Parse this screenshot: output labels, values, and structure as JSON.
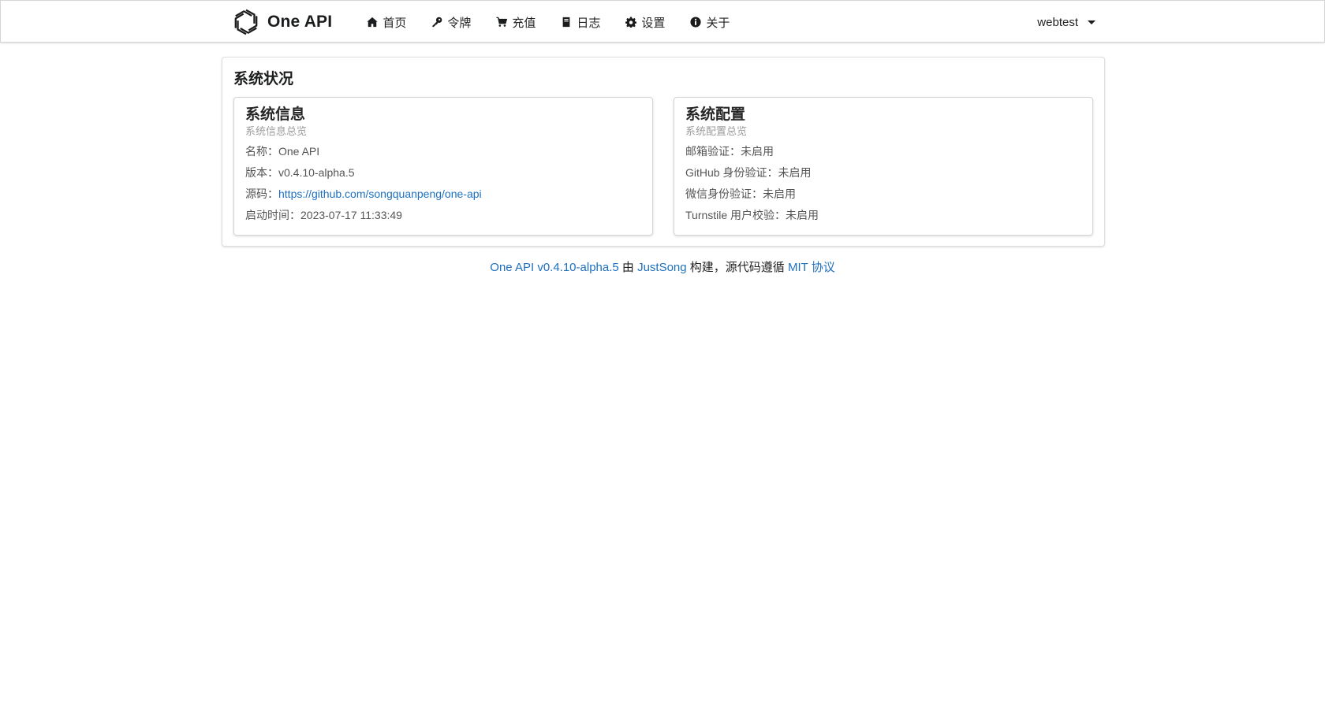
{
  "header": {
    "brand": "One API",
    "nav": [
      {
        "label": "首页",
        "icon": "home-icon"
      },
      {
        "label": "令牌",
        "icon": "key-icon"
      },
      {
        "label": "充值",
        "icon": "cart-icon"
      },
      {
        "label": "日志",
        "icon": "book-icon"
      },
      {
        "label": "设置",
        "icon": "gear-icon"
      },
      {
        "label": "关于",
        "icon": "info-icon"
      }
    ],
    "user": "webtest"
  },
  "main": {
    "title": "系统状况",
    "system_info": {
      "header": "系统信息",
      "meta": "系统信息总览",
      "name_label": "名称：",
      "name_value": "One API",
      "version_label": "版本：",
      "version_value": "v0.4.10-alpha.5",
      "source_label": "源码：",
      "source_link": "https://github.com/songquanpeng/one-api",
      "start_label": "启动时间：",
      "start_value": "2023-07-17 11:33:49"
    },
    "system_config": {
      "header": "系统配置",
      "meta": "系统配置总览",
      "rows": [
        "邮箱验证：未启用",
        "GitHub 身份验证：未启用",
        "微信身份验证：未启用",
        "Turnstile 用户校验：未启用"
      ]
    }
  },
  "footer": {
    "project_link": "One API v0.4.10-alpha.5",
    "by_text": " 由 ",
    "author_link": "JustSong",
    "mid_text": " 构建，源代码遵循 ",
    "license_link": "MIT 协议"
  },
  "colors": {
    "link": "#1e70bf",
    "text": "#333333"
  }
}
